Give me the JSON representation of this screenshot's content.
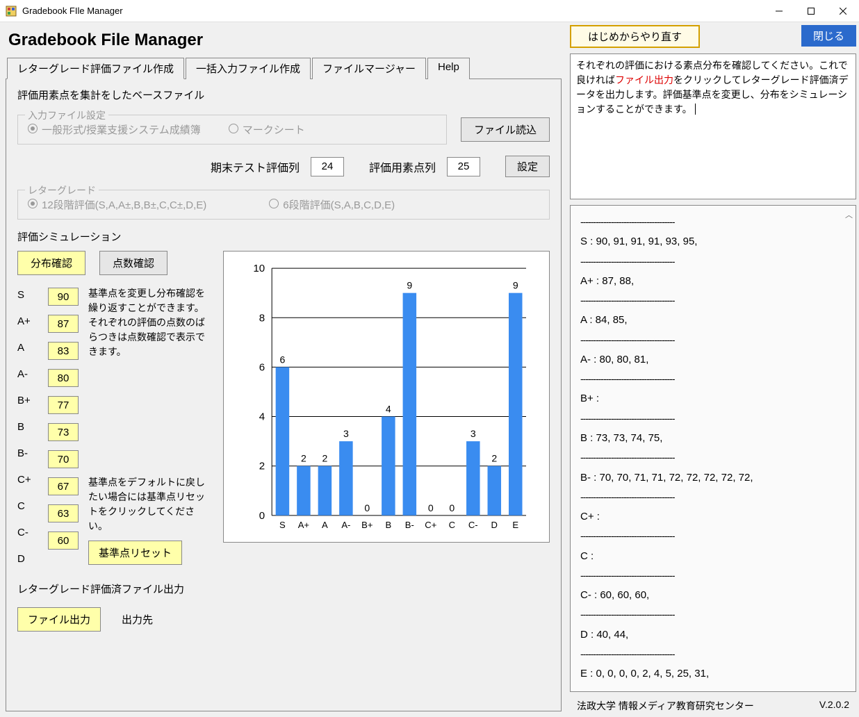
{
  "window": {
    "title": "Gradebook FIle Manager"
  },
  "header": {
    "app_title": "Gradebook File Manager"
  },
  "tabs": {
    "t1": "レターグレード評価ファイル作成",
    "t2": "一括入力ファイル作成",
    "t3": "ファイルマージャー",
    "t4": "Help"
  },
  "base_file": {
    "title": "評価用素点を集計をしたベースファイル",
    "group_title": "入力ファイル設定",
    "radio1": "一般形式/授業支援システム成績簿",
    "radio2": "マークシート",
    "load_btn": "ファイル読込",
    "col1_label": "期末テスト評価列",
    "col1_val": "24",
    "col2_label": "評価用素点列",
    "col2_val": "25",
    "set_btn": "設定"
  },
  "letter_grade": {
    "title": "レターグレード",
    "r1": "12段階評価(S,A,A±,B,B±,C,C±,D,E)",
    "r2": "6段階評価(S,A,B,C,D,E)"
  },
  "sim": {
    "title": "評価シミュレーション",
    "btn_dist": "分布確認",
    "btn_score": "点数確認",
    "grades": [
      "S",
      "A+",
      "A",
      "A-",
      "B+",
      "B",
      "B-",
      "C+",
      "C",
      "C-",
      "D"
    ],
    "thresholds": [
      "90",
      "87",
      "83",
      "80",
      "77",
      "73",
      "70",
      "67",
      "63",
      "60"
    ],
    "desc1": "基準点を変更し分布確認を繰り返すことができます。\nそれぞれの評価の点数のばらつきは点数確認で表示できます。",
    "desc2": "基準点をデフォルトに戻したい場合には基準点リセットをクリックしてください。",
    "reset_btn": "基準点リセット"
  },
  "output": {
    "title": "レターグレード評価済ファイル出力",
    "btn": "ファイル出力",
    "dest": "出力先"
  },
  "right": {
    "restart_btn": "はじめからやり直す",
    "close_btn": "閉じる",
    "info_pre": "それぞれの評価における素点分布を確認してください。これで良ければ",
    "info_red": "ファイル出力",
    "info_post": "をクリックしてレターグレード評価済データを出力します。評価基準点を変更し、分布をシミュレーションすることができます。",
    "dist_lines": [
      "S : 90, 91, 91, 91, 93, 95,",
      "A+ : 87, 88,",
      "A : 84, 85,",
      "A- : 80, 80, 81,",
      "B+ :",
      "B : 73, 73, 74, 75,",
      "B- : 70, 70, 71, 71, 72, 72, 72, 72, 72,",
      "C+ :",
      "C :",
      "C- : 60, 60, 60,",
      "D : 40, 44,",
      "E : 0, 0, 0, 0, 2, 4, 5, 25, 31,"
    ]
  },
  "footer": {
    "org": "法政大学  情報メディア教育研究センター",
    "ver": "V.2.0.2"
  },
  "chart_data": {
    "type": "bar",
    "categories": [
      "S",
      "A+",
      "A",
      "A-",
      "B+",
      "B",
      "B-",
      "C+",
      "C",
      "C-",
      "D",
      "E"
    ],
    "values": [
      6,
      2,
      2,
      3,
      0,
      4,
      9,
      0,
      0,
      3,
      2,
      9
    ],
    "ylim": [
      0,
      10
    ],
    "yticks": [
      0,
      2,
      4,
      6,
      8,
      10
    ],
    "title": "",
    "xlabel": "",
    "ylabel": ""
  }
}
